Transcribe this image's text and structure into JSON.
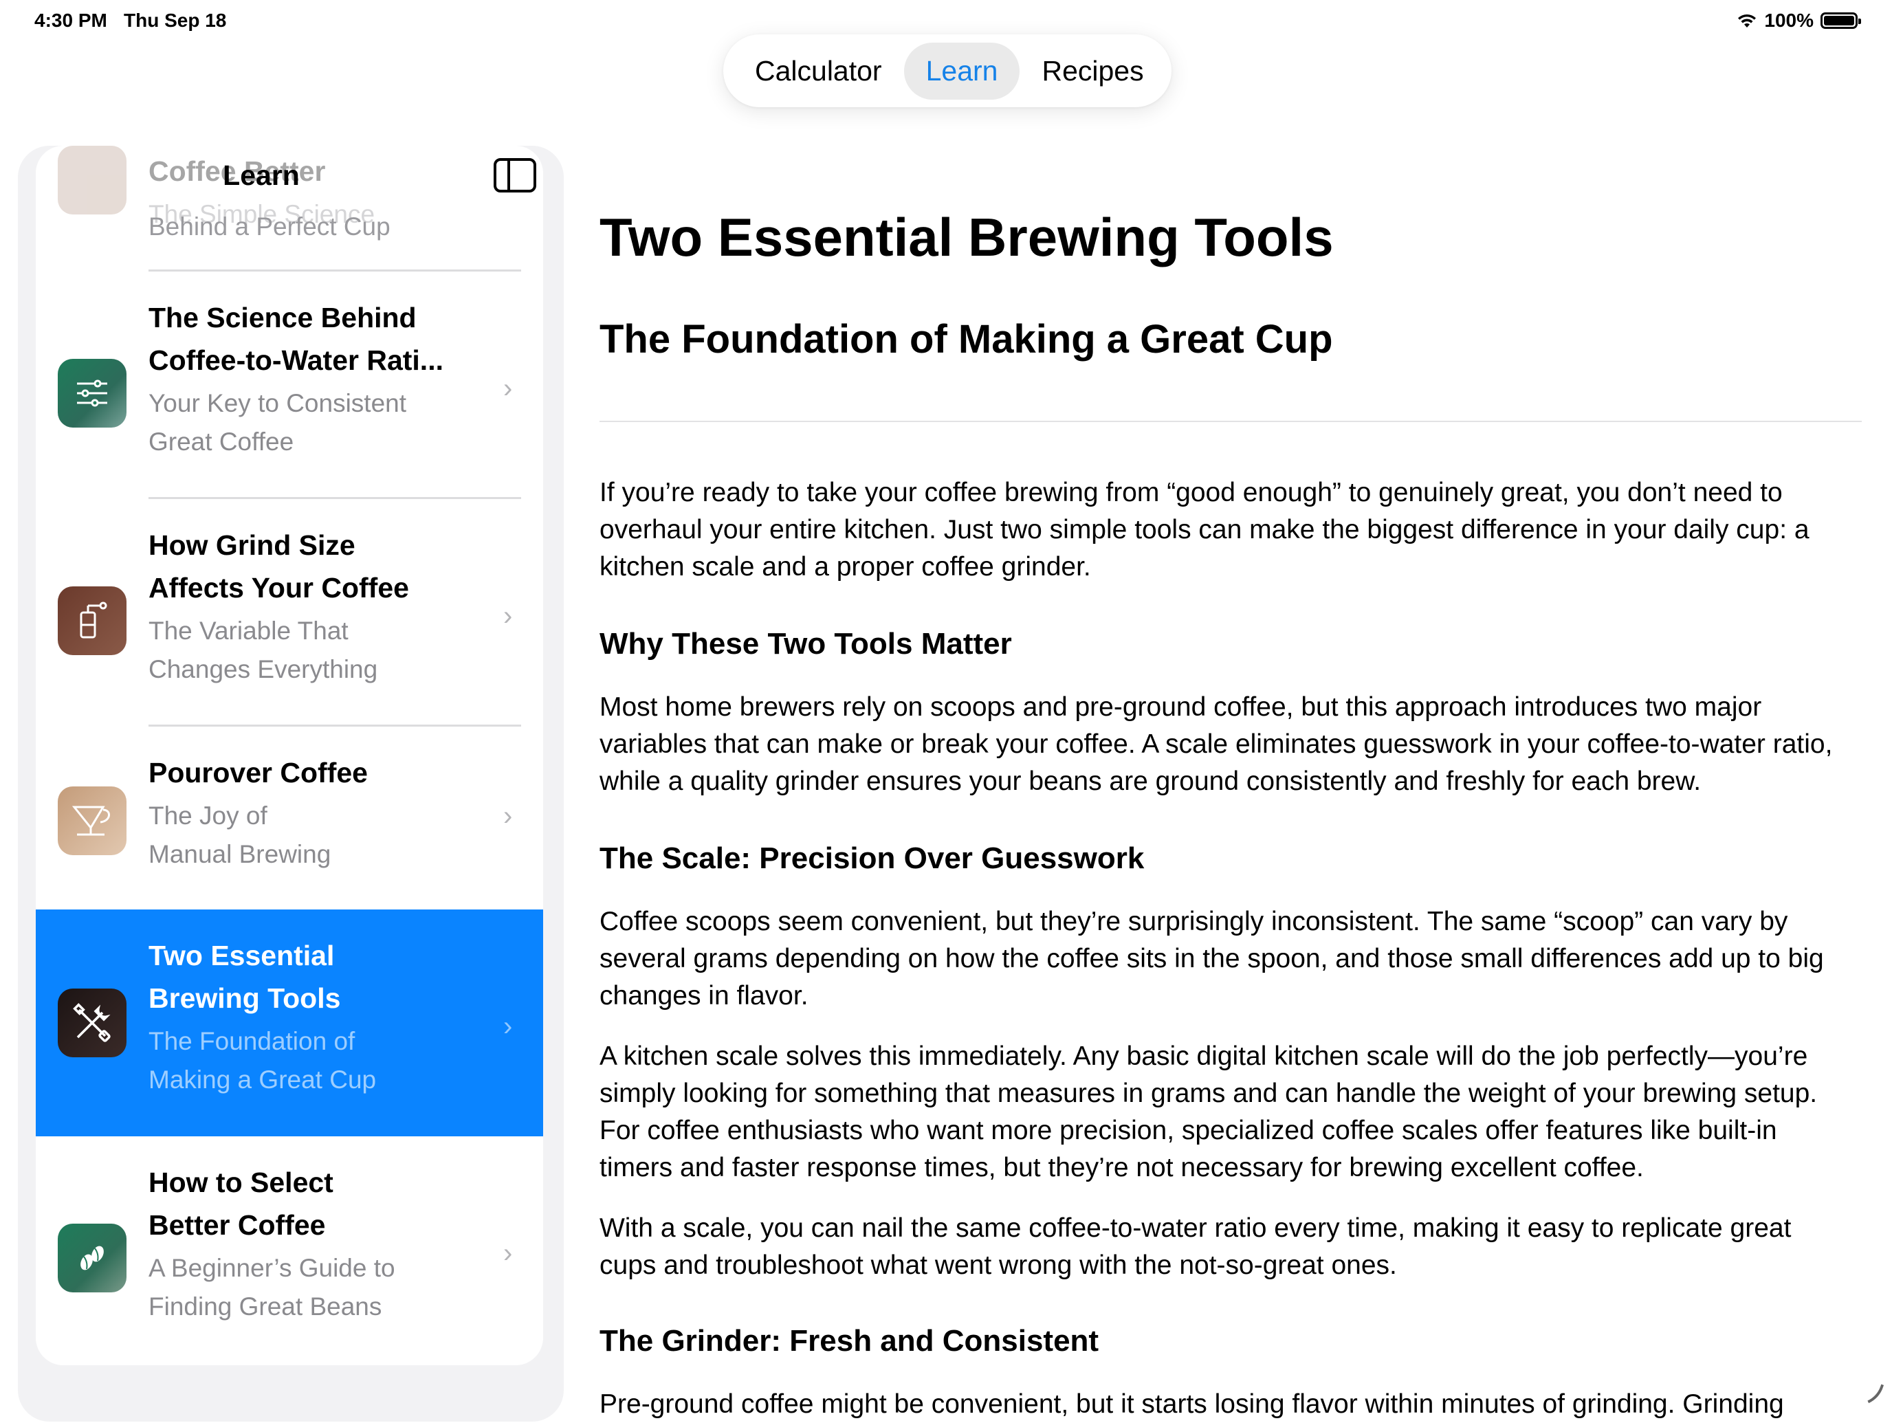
{
  "status_bar": {
    "time": "4:30 PM",
    "date": "Thu Sep 18",
    "battery": "100%"
  },
  "tabs": [
    {
      "label": "Calculator",
      "active": false
    },
    {
      "label": "Learn",
      "active": true
    },
    {
      "label": "Recipes",
      "active": false
    }
  ],
  "sidebar": {
    "title": "Learn",
    "items": [
      {
        "title": "Coffee Better",
        "subtitle": "The Simple Science Behind a Perfect Cup",
        "subtitle_l1": "The Simple Science",
        "subtitle_l2": "Behind a Perfect Cup",
        "icon": "coffee-cup-icon"
      },
      {
        "title_l1": "The Science Behind",
        "title_l2": "Coffee-to-Water Rati...",
        "subtitle_l1": "Your Key to Consistent",
        "subtitle_l2": "Great Coffee",
        "icon": "sliders-icon",
        "color": "#1f7a5a"
      },
      {
        "title_l1": "How Grind Size",
        "title_l2": "Affects Your Coffee",
        "subtitle_l1": "The Variable That",
        "subtitle_l2": "Changes Everything",
        "icon": "grinder-icon",
        "color": "#7a4a3a"
      },
      {
        "title_l1": "Pourover Coffee",
        "subtitle_l1": "The Joy of",
        "subtitle_l2": "Manual Brewing",
        "icon": "pourover-icon",
        "color": "#c9a98a"
      },
      {
        "title_l1": "Two Essential",
        "title_l2": "Brewing Tools",
        "subtitle_l1": "The Foundation of",
        "subtitle_l2": "Making a Great Cup",
        "icon": "tools-icon",
        "color": "#2a1f1e",
        "selected": true
      },
      {
        "title_l1": "How to Select",
        "title_l2": "Better Coffee",
        "subtitle_l1": "A Beginner’s Guide to",
        "subtitle_l2": "Finding Great Beans",
        "icon": "coffee-bean-icon",
        "color": "#1f7a5a"
      }
    ]
  },
  "article": {
    "title": "Two Essential Brewing Tools",
    "subtitle": "The Foundation of Making a Great Cup",
    "intro_l1": "If you’re ready to take your coffee brewing from “good enough” to genuinely great, you don’t need to",
    "intro_l2": "overhaul your entire kitchen. Just two simple tools can make the biggest difference in your daily cup: a",
    "intro_l3": "kitchen scale and a proper coffee grinder.",
    "h_why": "Why These Two Tools Matter",
    "why_l1": "Most home brewers rely on scoops and pre-ground coffee, but this approach introduces two major",
    "why_l2": "variables that can make or break your coffee. A scale eliminates guesswork in your coffee-to-water ratio,",
    "why_l3": "while a quality grinder ensures your beans are ground consistently and freshly for each brew.",
    "h_scale": "The Scale: Precision Over Guesswork",
    "scale1_l1": "Coffee scoops seem convenient, but they’re surprisingly inconsistent. The same “scoop” can vary by",
    "scale1_l2": "several grams depending on how the coffee sits in the spoon, and those small differences add up to big",
    "scale1_l3": "changes in flavor.",
    "scale2_l1": "A kitchen scale solves this immediately. Any basic digital kitchen scale will do the job perfectly—you’re",
    "scale2_l2": "simply looking for something that measures in grams and can handle the weight of your brewing setup.",
    "scale2_l3": "For coffee enthusiasts who want more precision, specialized coffee scales offer features like built-in",
    "scale2_l4": "timers and faster response times, but they’re not necessary for brewing excellent coffee.",
    "scale3_l1": "With a scale, you can nail the same coffee-to-water ratio every time, making it easy to replicate great",
    "scale3_l2": "cups and troubleshoot what went wrong with the not-so-great ones.",
    "h_grinder": "The Grinder: Fresh and Consistent",
    "grinder_l1": "Pre-ground coffee might be convenient, but it starts losing flavor within minutes of grinding. Grinding"
  }
}
